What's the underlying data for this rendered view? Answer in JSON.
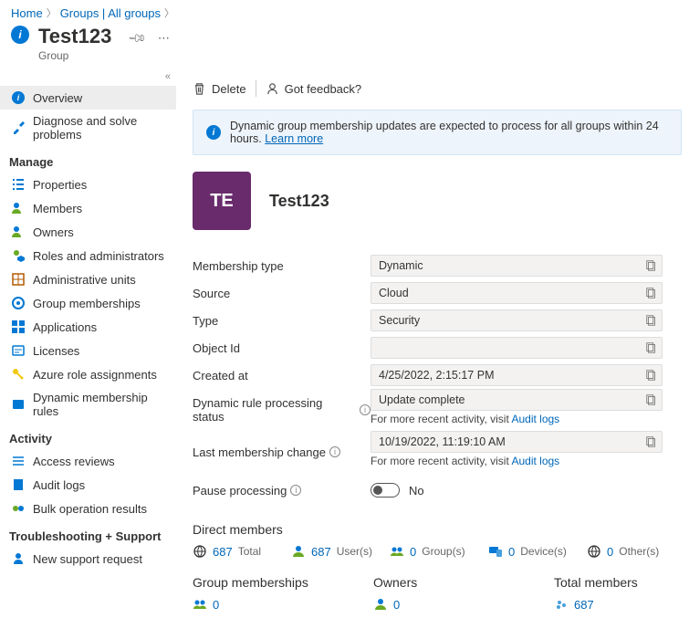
{
  "breadcrumb": {
    "home": "Home",
    "groups": "Groups | All groups"
  },
  "header": {
    "title": "Test123",
    "subtitle": "Group"
  },
  "toolbar": {
    "delete": "Delete",
    "feedback": "Got feedback?"
  },
  "banner": {
    "text": "Dynamic group membership updates are expected to process for all groups within 24 hours.",
    "link": "Learn more"
  },
  "sidebar": {
    "overview": "Overview",
    "diagnose": "Diagnose and solve problems",
    "manage_header": "Manage",
    "properties": "Properties",
    "members": "Members",
    "owners": "Owners",
    "roles": "Roles and administrators",
    "admin_units": "Administrative units",
    "group_memberships": "Group memberships",
    "applications": "Applications",
    "licenses": "Licenses",
    "azure_roles": "Azure role assignments",
    "dynamic_rules": "Dynamic membership rules",
    "activity_header": "Activity",
    "access_reviews": "Access reviews",
    "audit_logs": "Audit logs",
    "bulk_results": "Bulk operation results",
    "troubleshoot_header": "Troubleshooting + Support",
    "support": "New support request"
  },
  "group": {
    "avatar_initials": "TE",
    "name": "Test123"
  },
  "props": {
    "membership_type": {
      "label": "Membership type",
      "value": "Dynamic"
    },
    "source": {
      "label": "Source",
      "value": "Cloud"
    },
    "type": {
      "label": "Type",
      "value": "Security"
    },
    "object_id": {
      "label": "Object Id",
      "value": ""
    },
    "created_at": {
      "label": "Created at",
      "value": "4/25/2022, 2:15:17 PM"
    },
    "rule_status": {
      "label": "Dynamic rule processing status",
      "value": "Update complete",
      "hint_prefix": "For more recent activity, visit ",
      "hint_link": "Audit logs"
    },
    "last_change": {
      "label": "Last membership change",
      "value": "10/19/2022, 11:19:10 AM",
      "hint_prefix": "For more recent activity, visit ",
      "hint_link": "Audit logs"
    },
    "pause": {
      "label": "Pause processing",
      "value": "No"
    }
  },
  "stats": {
    "direct_header": "Direct members",
    "total": {
      "count": "687",
      "label": "Total"
    },
    "users": {
      "count": "687",
      "label": "User(s)"
    },
    "groups": {
      "count": "0",
      "label": "Group(s)"
    },
    "devices": {
      "count": "0",
      "label": "Device(s)"
    },
    "others": {
      "count": "0",
      "label": "Other(s)"
    },
    "memberships_header": "Group memberships",
    "memberships_count": "0",
    "owners_header": "Owners",
    "owners_count": "0",
    "total_members_header": "Total members",
    "total_members_count": "687"
  }
}
